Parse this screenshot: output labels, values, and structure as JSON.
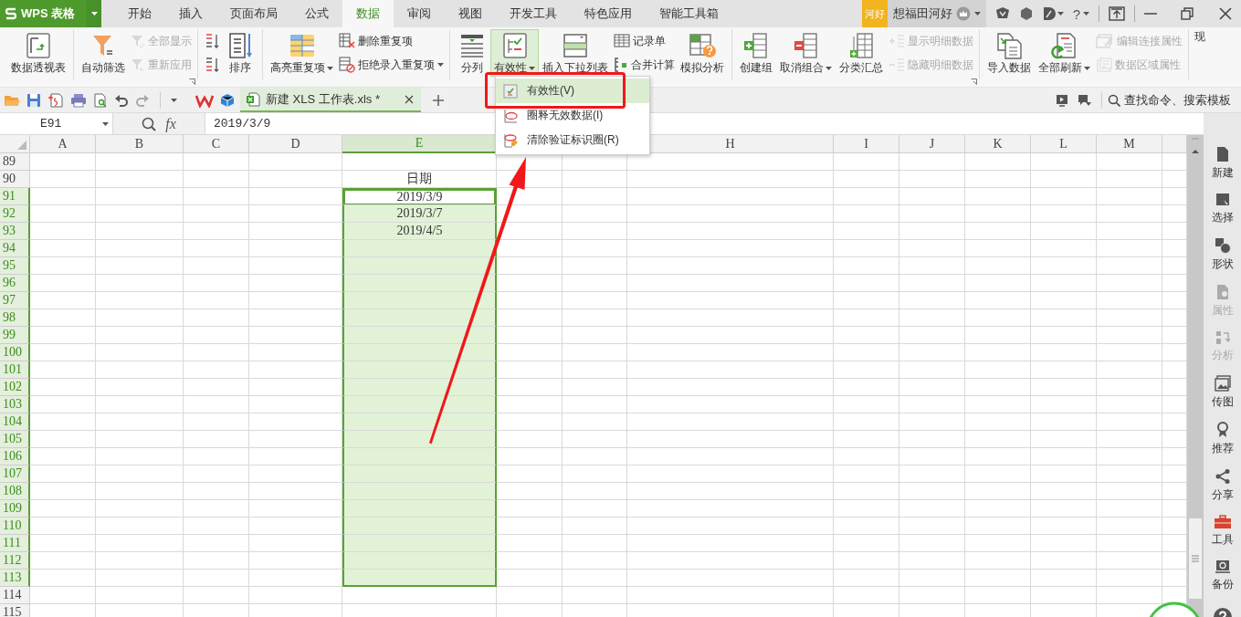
{
  "app": {
    "logo": "WPS 表格"
  },
  "tabs": [
    {
      "label": "开始",
      "selected": false
    },
    {
      "label": "插入",
      "selected": false
    },
    {
      "label": "页面布局",
      "selected": false
    },
    {
      "label": "公式",
      "selected": false
    },
    {
      "label": "数据",
      "selected": true
    },
    {
      "label": "审阅",
      "selected": false
    },
    {
      "label": "视图",
      "selected": false
    },
    {
      "label": "开发工具",
      "selected": false
    },
    {
      "label": "特色应用",
      "selected": false
    },
    {
      "label": "智能工具箱",
      "selected": false
    }
  ],
  "account": {
    "badge": "河好",
    "name": "想福田河好",
    "help": "?"
  },
  "ribbon": {
    "groups": [
      {
        "launcher": false,
        "items": [
          {
            "kind": "large",
            "label": "数据透视表",
            "disabled": false,
            "dropdown": false,
            "pressed": false
          }
        ]
      },
      {
        "launcher": true,
        "items": [
          {
            "kind": "large",
            "label": "自动筛选",
            "disabled": false,
            "dropdown": false,
            "pressed": false
          },
          {
            "kind": "stack",
            "items": [
              {
                "label": "全部显示",
                "disabled": true,
                "dropdown": false
              },
              {
                "label": "重新应用",
                "disabled": true,
                "dropdown": false
              }
            ]
          }
        ]
      },
      {
        "launcher": false,
        "items": [
          {
            "kind": "stack",
            "items": [
              {
                "disabled": false,
                "dropdown": false
              },
              {
                "disabled": false,
                "dropdown": false
              }
            ]
          },
          {
            "kind": "large",
            "label": "排序",
            "disabled": false,
            "dropdown": false,
            "pressed": false
          }
        ]
      },
      {
        "launcher": false,
        "items": [
          {
            "kind": "large",
            "label": "高亮重复项",
            "disabled": false,
            "dropdown": true,
            "pressed": false
          },
          {
            "kind": "stack",
            "items": [
              {
                "label": "删除重复项",
                "disabled": false,
                "dropdown": false
              },
              {
                "label": "拒绝录入重复项",
                "disabled": false,
                "dropdown": true
              }
            ]
          }
        ]
      },
      {
        "launcher": false,
        "items": [
          {
            "kind": "large",
            "label": "分列",
            "disabled": false,
            "dropdown": false,
            "pressed": false
          },
          {
            "kind": "large",
            "label": "有效性",
            "disabled": false,
            "dropdown": true,
            "pressed": true
          },
          {
            "kind": "large",
            "label": "插入下拉列表",
            "disabled": false,
            "dropdown": false,
            "pressed": false
          },
          {
            "kind": "stack",
            "items": [
              {
                "label": "记录单",
                "disabled": false,
                "dropdown": false
              },
              {
                "label": "合并计算",
                "disabled": false,
                "dropdown": false
              }
            ]
          },
          {
            "kind": "large",
            "label": "模拟分析",
            "disabled": false,
            "dropdown": false,
            "pressed": false
          }
        ]
      },
      {
        "launcher": true,
        "items": [
          {
            "kind": "large",
            "label": "创建组",
            "disabled": false,
            "dropdown": false,
            "pressed": false
          },
          {
            "kind": "large",
            "label": "取消组合",
            "disabled": false,
            "dropdown": true,
            "pressed": false
          },
          {
            "kind": "large",
            "label": "分类汇总",
            "disabled": false,
            "dropdown": false,
            "pressed": false
          },
          {
            "kind": "stack",
            "items": [
              {
                "label": "显示明细数据",
                "disabled": true,
                "dropdown": false
              },
              {
                "label": "隐藏明细数据",
                "disabled": true,
                "dropdown": false
              }
            ]
          }
        ]
      },
      {
        "launcher": false,
        "items": [
          {
            "kind": "large",
            "label": "导入数据",
            "disabled": false,
            "dropdown": false,
            "pressed": false
          },
          {
            "kind": "large",
            "label": "全部刷新",
            "disabled": false,
            "dropdown": true,
            "pressed": false
          },
          {
            "kind": "stack",
            "items": [
              {
                "label": "编辑连接属性",
                "disabled": true,
                "dropdown": false
              },
              {
                "label": "数据区域属性",
                "disabled": true,
                "dropdown": false
              }
            ]
          }
        ]
      },
      {
        "launcher": false,
        "items": [
          {
            "kind": "cut",
            "label": "现",
            "disabled": false,
            "dropdown": false,
            "pressed": false
          }
        ]
      }
    ]
  },
  "quickbar": {
    "document_tab": {
      "title": "新建 XLS 工作表.xls *",
      "selected": true
    },
    "search": {
      "placeholder": "查找命令、搜索模板"
    }
  },
  "formula_bar": {
    "name_box": "E91",
    "fx": "fx",
    "value": "2019/3/9"
  },
  "sheet": {
    "columns": [
      {
        "label": "A",
        "selected": false
      },
      {
        "label": "B",
        "selected": false
      },
      {
        "label": "C",
        "selected": false
      },
      {
        "label": "D",
        "selected": false
      },
      {
        "label": "E",
        "selected": true
      },
      {
        "label": "H",
        "selected": false
      },
      {
        "label": "I",
        "selected": false
      },
      {
        "label": "J",
        "selected": false
      },
      {
        "label": "K",
        "selected": false
      },
      {
        "label": "L",
        "selected": false
      },
      {
        "label": "M",
        "selected": false
      },
      {
        "selected": false
      }
    ],
    "rows": [
      {
        "label": "89",
        "selected": false,
        "active": false
      },
      {
        "label": "90",
        "selected": false,
        "active": false,
        "column_e": "日期"
      },
      {
        "label": "91",
        "selected": true,
        "active": true,
        "column_e": "2019/3/9"
      },
      {
        "label": "92",
        "selected": true,
        "active": false,
        "column_e": "2019/3/7"
      },
      {
        "label": "93",
        "selected": true,
        "active": false,
        "column_e": "2019/4/5"
      },
      {
        "label": "94",
        "selected": true,
        "active": false
      },
      {
        "label": "95",
        "selected": true,
        "active": false
      },
      {
        "label": "96",
        "selected": true,
        "active": false
      },
      {
        "label": "97",
        "selected": true,
        "active": false
      },
      {
        "label": "98",
        "selected": true,
        "active": false
      },
      {
        "label": "99",
        "selected": true,
        "active": false
      },
      {
        "label": "100",
        "selected": true,
        "active": false
      },
      {
        "label": "101",
        "selected": true,
        "active": false
      },
      {
        "label": "102",
        "selected": true,
        "active": false
      },
      {
        "label": "103",
        "selected": true,
        "active": false
      },
      {
        "label": "104",
        "selected": true,
        "active": false
      },
      {
        "label": "105",
        "selected": true,
        "active": false
      },
      {
        "label": "106",
        "selected": true,
        "active": false
      },
      {
        "label": "107",
        "selected": true,
        "active": false
      },
      {
        "label": "108",
        "selected": true,
        "active": false
      },
      {
        "label": "109",
        "selected": true,
        "active": false
      },
      {
        "label": "110",
        "selected": true,
        "active": false
      },
      {
        "label": "111",
        "selected": true,
        "active": false
      },
      {
        "label": "112",
        "selected": true,
        "active": false
      },
      {
        "label": "113",
        "selected": true,
        "active": false
      },
      {
        "label": "114",
        "selected": false,
        "active": false
      },
      {
        "label": "115",
        "selected": false,
        "active": false
      }
    ]
  },
  "menu": {
    "items": [
      {
        "label": "有效性(V)",
        "selected": true
      },
      {
        "label": "圈释无效数据(I)",
        "selected": false
      },
      {
        "label": "清除验证标识圈(R)",
        "selected": false
      }
    ]
  },
  "sidebar": {
    "items": [
      {
        "label": "新建",
        "disabled": false
      },
      {
        "label": "选择",
        "disabled": false
      },
      {
        "label": "形状",
        "disabled": false
      },
      {
        "label": "属性",
        "disabled": true
      },
      {
        "label": "分析",
        "disabled": true
      },
      {
        "label": "传图",
        "disabled": false
      },
      {
        "label": "推荐",
        "disabled": false
      },
      {
        "label": "分享",
        "disabled": false
      },
      {
        "label": "工具",
        "disabled": false
      },
      {
        "label": "备份",
        "disabled": false
      }
    ]
  }
}
